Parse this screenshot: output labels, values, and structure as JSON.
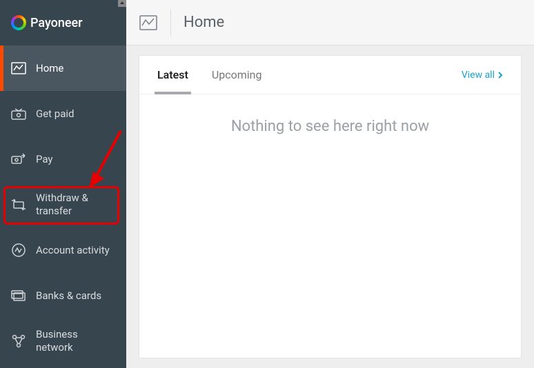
{
  "brand": {
    "name": "Payoneer"
  },
  "sidebar": {
    "items": [
      {
        "label": "Home"
      },
      {
        "label": "Get paid"
      },
      {
        "label": "Pay"
      },
      {
        "label": "Withdraw & transfer"
      },
      {
        "label": "Account activity"
      },
      {
        "label": "Banks & cards"
      },
      {
        "label": "Business network"
      }
    ]
  },
  "header": {
    "title": "Home"
  },
  "tabs": {
    "items": [
      {
        "label": "Latest"
      },
      {
        "label": "Upcoming"
      }
    ],
    "viewall": "View all"
  },
  "empty_message": "Nothing to see here right now",
  "annotation": {
    "highlighted_item": "Withdraw & transfer"
  }
}
